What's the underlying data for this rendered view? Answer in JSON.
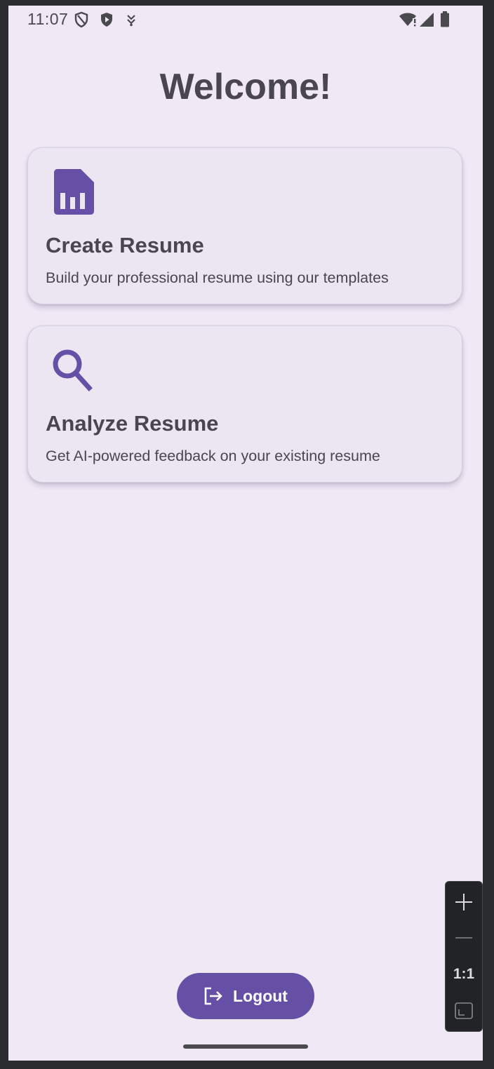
{
  "status_bar": {
    "time": "11:07",
    "left_icons": [
      "shield-outline-icon",
      "shield-play-icon",
      "download-icon"
    ],
    "right_icons": [
      "wifi-alert-icon",
      "signal-icon",
      "battery-icon"
    ]
  },
  "page": {
    "title": "Welcome!"
  },
  "cards": [
    {
      "icon": "document-chart-icon",
      "title": "Create Resume",
      "description": "Build your professional resume using our templates"
    },
    {
      "icon": "search-icon",
      "title": "Analyze Resume",
      "description": "Get AI-powered feedback on your existing resume"
    }
  ],
  "logout": {
    "label": "Logout",
    "icon": "logout-icon"
  },
  "zoom_controls": {
    "zoom_in_icon": "plus-icon",
    "zoom_out_icon": "minus-icon",
    "ratio_label": "1:1",
    "fit_icon": "fit-screen-icon"
  },
  "colors": {
    "background": "#f0e9f5",
    "card_background": "#ece5f2",
    "accent": "#6650a5",
    "text": "#4a4650"
  }
}
